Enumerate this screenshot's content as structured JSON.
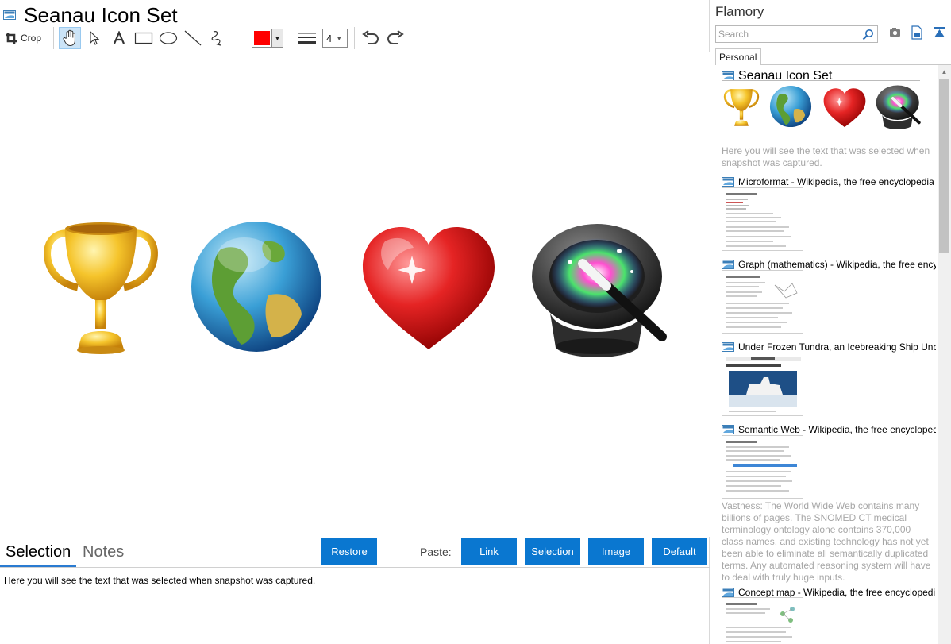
{
  "document": {
    "title": "Seanau Icon Set"
  },
  "toolbar": {
    "crop_label": "Crop",
    "tools": [
      "hand-tool",
      "pointer-tool",
      "text-tool",
      "rectangle-tool",
      "ellipse-tool",
      "line-tool",
      "freehand-tool"
    ],
    "stroke_color": "#ff0000",
    "stroke_width": "4"
  },
  "canvas": {
    "icons": [
      "trophy-icon",
      "globe-icon",
      "heart-icon",
      "magic-hat-icon"
    ]
  },
  "bottom": {
    "tab_selection": "Selection",
    "tab_notes": "Notes",
    "restore_label": "Restore",
    "paste_label": "Paste:",
    "link_label": "Link",
    "selection_label": "Selection",
    "image_label": "Image",
    "default_label": "Default",
    "selection_text": "Here you will see the text that was selected when snapshot was captured."
  },
  "sidebar": {
    "app_title": "Flamory",
    "search_placeholder": "Search",
    "tab_personal": "Personal",
    "entries": [
      {
        "title": "Seanau Icon Set",
        "note": "Here you will see the text that was selected when snapshot was captured."
      },
      {
        "title": "Microformat - Wikipedia, the free encyclopedia"
      },
      {
        "title": "Graph (mathematics) - Wikipedia, the free ency"
      },
      {
        "title": "Under Frozen Tundra, an Icebreaking Ship Unco"
      },
      {
        "title": "Semantic Web - Wikipedia, the free encycloped",
        "note": "Vastness: The World Wide Web contains many billions of pages. The SNOMED CT medical terminology ontology alone contains 370,000 class names, and existing technology has not yet been able to eliminate all semantically duplicated terms. Any automated reasoning system will have to deal with truly huge inputs."
      },
      {
        "title": "Concept map - Wikipedia, the free encyclopedi"
      }
    ]
  },
  "colors": {
    "accent": "#0a77d0",
    "tab_underline": "#2a7bd1",
    "active_tool": "#cce4f7"
  }
}
